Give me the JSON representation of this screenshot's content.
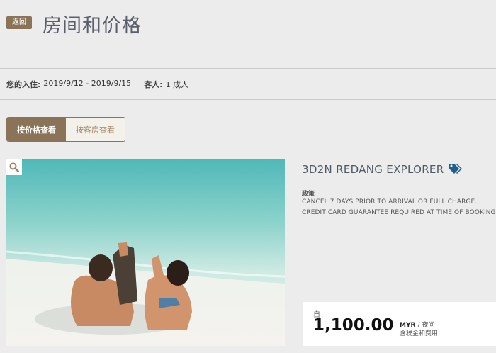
{
  "header": {
    "back_label": "返回",
    "title": "房间和价格"
  },
  "stay": {
    "checkin_label": "您的入住:",
    "dates": "2019/9/12 - 2019/9/15",
    "guests_label": "客人:",
    "guests_value": "1 成人"
  },
  "view_toggle": {
    "by_price": "按价格查看",
    "by_room": "按客房查看",
    "selected": "by_price"
  },
  "offer": {
    "title": "3D2N REDANG EXPLORER",
    "policy_label": "政策",
    "policy_lines": [
      "CANCEL 7 DAYS PRIOR TO ARRIVAL OR FULL CHARGE.",
      "CREDIT CARD GUARANTEE REQUIRED AT TIME OF BOOKING."
    ],
    "price_from": "自",
    "price": "1,100.00",
    "currency": "MYR",
    "per_night": "/ 夜间",
    "tax_note": "含税金和费用"
  },
  "icons": {
    "zoom": "magnifier-icon",
    "tag": "price-tag-icon"
  },
  "colors": {
    "brand_brown": "#8b7358",
    "title_gray": "#5a5f6b",
    "tag_blue": "#1f5f8f",
    "background": "#ececec"
  }
}
